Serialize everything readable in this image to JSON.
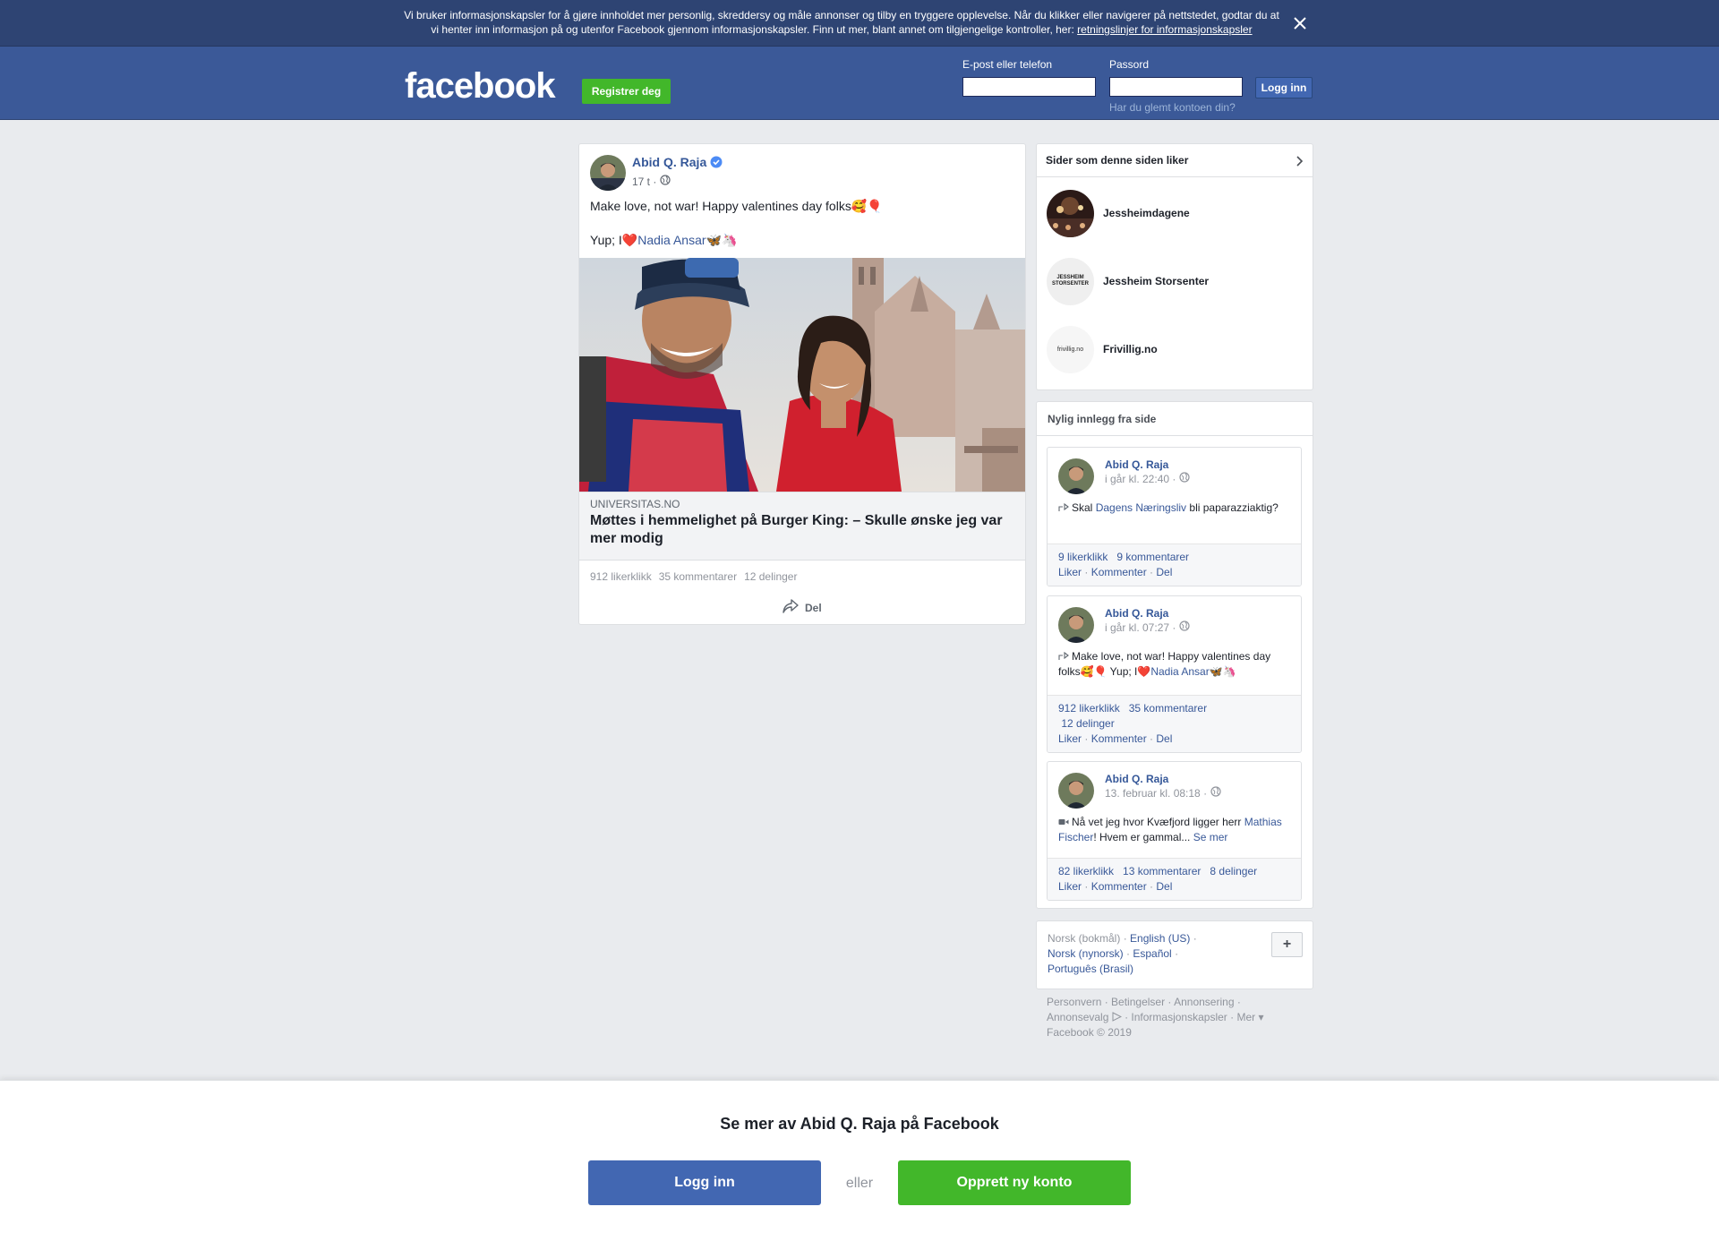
{
  "cookie": {
    "line1": "Vi bruker informasjonskapsler for å gjøre innholdet mer personlig, skreddersy og måle annonser og tilby en tryggere opplevelse. Når du klikker eller navigerer på nettstedet, godtar du at",
    "line2": "vi henter inn informasjon på og utenfor Facebook gjennom informasjonskapsler. Finn ut mer, blant annet om tilgjengelige kontroller, her: ",
    "policy_link": "retningslinjer for informasjonskapsler"
  },
  "header": {
    "logo": "facebook",
    "register": "Registrer deg",
    "email_label": "E-post eller telefon",
    "password_label": "Passord",
    "login": "Logg inn",
    "forgot": "Har du glemt kontoen din?"
  },
  "post": {
    "author": "Abid Q. Raja",
    "time": "17 t ·",
    "text1": "Make love, not war! Happy valentines day folks🥰🎈",
    "text2_prefix": "Yup; I❤️",
    "text2_link": "Nadia Ansar",
    "text2_suffix": "🦋🦄",
    "link_domain": "UNIVERSITAS.NO",
    "link_headline": "Møttes i hemmelighet på Burger King: – Skulle ønske jeg var mer modig",
    "likes": "912 likerklikk",
    "comments": "35 kommentarer",
    "shares": "12 delinger",
    "share_btn": "Del"
  },
  "pages_box": {
    "title": "Sider som denne siden liker",
    "items": [
      {
        "name": "Jessheimdagene"
      },
      {
        "name": "Jessheim Storsenter",
        "thumb_text": "JESSHEIM STORSENTER"
      },
      {
        "name": "Frivillig.no",
        "thumb_text": "frivillig.no"
      }
    ]
  },
  "recent": {
    "title": "Nylig innlegg fra side",
    "items": [
      {
        "author": "Abid Q. Raja",
        "time": "i går kl. 22:40 ·",
        "text_a": "Skal ",
        "text_link": "Dagens Næringsliv",
        "text_b": " bli paparazziaktig?",
        "stat1": "9 likerklikk",
        "stat2": "9 kommentarer",
        "stat3": "",
        "like": "Liker",
        "comment": "Kommenter",
        "share": "Del"
      },
      {
        "author": "Abid Q. Raja",
        "time": "i går kl. 07:27 ·",
        "text_a": "Make love, not war! Happy valentines day folks🥰🎈   Yup; I❤️",
        "text_link": "Nadia Ansar",
        "text_b": "🦋🦄",
        "stat1": "912 likerklikk",
        "stat2": "35 kommentarer",
        "stat3": "12 delinger",
        "like": "Liker",
        "comment": "Kommenter",
        "share": "Del"
      },
      {
        "author": "Abid Q. Raja",
        "time": "13. februar kl. 08:18 ·",
        "text_a": "Nå vet jeg hvor Kvæfjord ligger herr ",
        "text_link": "Mathias Fischer",
        "text_b": "! Hvem er gammal... ",
        "see_more": "Se mer",
        "stat1": "82 likerklikk",
        "stat2": "13 kommentarer",
        "stat3": "8 delinger",
        "like": "Liker",
        "comment": "Kommenter",
        "share": "Del"
      }
    ]
  },
  "languages": {
    "current": "Norsk (bokmål)",
    "others": [
      "English (US)",
      "Norsk (nynorsk)",
      "Español",
      "Português (Brasil)"
    ],
    "plus": "+"
  },
  "footer": {
    "links": [
      "Personvern",
      "Betingelser",
      "Annonsering",
      "Annonsevalg",
      "Informasjonskapsler",
      "Mer"
    ],
    "copyright": "Facebook © 2019"
  },
  "bottom": {
    "title": "Se mer av Abid Q. Raja på Facebook",
    "login": "Logg inn",
    "or": "eller",
    "create": "Opprett ny konto"
  },
  "colors": {
    "brand_blue": "#3b5998",
    "button_blue": "#4267b2",
    "green": "#42b72a",
    "link": "#385898"
  }
}
